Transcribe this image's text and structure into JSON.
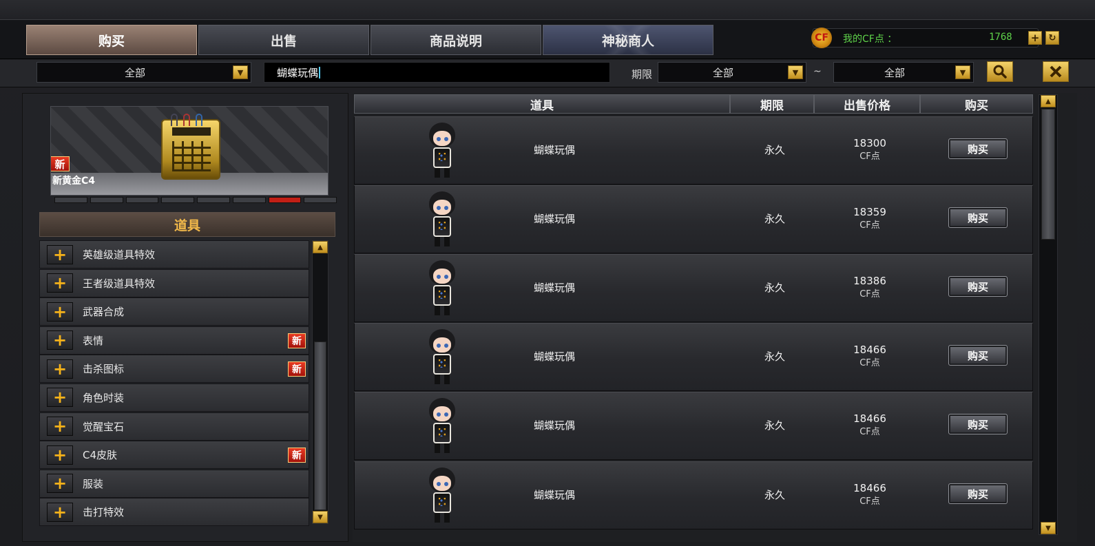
{
  "tabs": [
    {
      "label": "购买",
      "active": true
    },
    {
      "label": "出售",
      "active": false
    },
    {
      "label": "商品说明",
      "active": false
    },
    {
      "label": "神秘商人",
      "active": false
    }
  ],
  "cf": {
    "logo_text": "CF",
    "label": "我的CF点 ：",
    "value": "1768"
  },
  "filters": {
    "category": "全部",
    "search_value": "蝴蝶玩偶",
    "period_label": "期限",
    "period_from": "全部",
    "tilde": "~",
    "period_to": "全部"
  },
  "icons": {
    "dropdown": "chevron-down-icon",
    "search": "magnifier-icon",
    "close": "close-x-icon",
    "add": "plus-icon",
    "refresh": "refresh-icon",
    "expand": "plus-icon"
  },
  "showcase": {
    "badge": "新",
    "name": "新黄金C4",
    "slide_count": 8,
    "active_slide": 7
  },
  "left_panel": {
    "title": "道具",
    "categories": [
      {
        "label": "英雄级道具特效",
        "new": false
      },
      {
        "label": "王者级道具特效",
        "new": false
      },
      {
        "label": "武器合成",
        "new": false
      },
      {
        "label": "表情",
        "new": true,
        "badge": "新"
      },
      {
        "label": "击杀图标",
        "new": true,
        "badge": "新"
      },
      {
        "label": "角色时装",
        "new": false
      },
      {
        "label": "觉醒宝石",
        "new": false
      },
      {
        "label": "C4皮肤",
        "new": true,
        "badge": "新"
      },
      {
        "label": "服装",
        "new": false
      },
      {
        "label": "击打特效",
        "new": false
      }
    ]
  },
  "table": {
    "headers": [
      "道具",
      "期限",
      "出售价格",
      "购买"
    ],
    "rows": [
      {
        "name": "蝴蝶玩偶",
        "period": "永久",
        "price": "18300",
        "unit": "CF点",
        "buy_label": "购买"
      },
      {
        "name": "蝴蝶玩偶",
        "period": "永久",
        "price": "18359",
        "unit": "CF点",
        "buy_label": "购买"
      },
      {
        "name": "蝴蝶玩偶",
        "period": "永久",
        "price": "18386",
        "unit": "CF点",
        "buy_label": "购买"
      },
      {
        "name": "蝴蝶玩偶",
        "period": "永久",
        "price": "18466",
        "unit": "CF点",
        "buy_label": "购买"
      },
      {
        "name": "蝴蝶玩偶",
        "period": "永久",
        "price": "18466",
        "unit": "CF点",
        "buy_label": "购买"
      },
      {
        "name": "蝴蝶玩偶",
        "period": "永久",
        "price": "18466",
        "unit": "CF点",
        "buy_label": "购买"
      }
    ]
  },
  "colors": {
    "accent_gold": "#f4d36a",
    "cf_green": "#5fd34a",
    "new_red": "#c21f16",
    "title_orange": "#f2b94a"
  }
}
